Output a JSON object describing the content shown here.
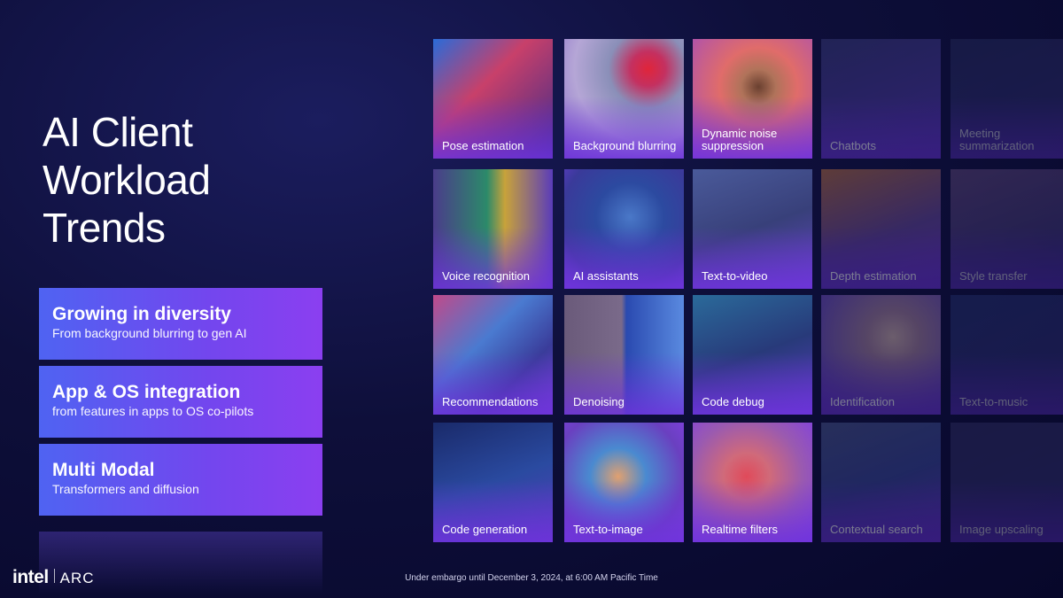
{
  "slide": {
    "title_lines": [
      "AI Client",
      "Workload",
      "Trends"
    ],
    "pills": [
      {
        "title": "Growing in diversity",
        "subtitle": "From background blurring to gen AI"
      },
      {
        "title": "App & OS integration",
        "subtitle": "from features in apps to OS co-pilots"
      },
      {
        "title": "Multi Modal",
        "subtitle": "Transformers and diffusion"
      }
    ],
    "tiles": [
      [
        "Pose estimation",
        "Background blurring",
        "Dynamic noise suppression",
        "Chatbots",
        "Meeting summarization"
      ],
      [
        "Voice recognition",
        "AI assistants",
        "Text-to-video",
        "Depth estimation",
        "Style transfer"
      ],
      [
        "Recommendations",
        "Denoising",
        "Code debug",
        "Identification",
        "Text-to-music"
      ],
      [
        "Code generation",
        "Text-to-image",
        "Realtime filters",
        "Contextual search",
        "Image upscaling"
      ]
    ],
    "logo": {
      "brand": "intel",
      "product": "ARC"
    },
    "embargo": "Under embargo until December 3, 2024, at 6:00 AM Pacific Time"
  },
  "colors": {
    "background": "#0e0f3a",
    "pill_start": "#4f63f2",
    "pill_end": "#8b3ff0",
    "tile_overlay": "#6e32dc"
  }
}
